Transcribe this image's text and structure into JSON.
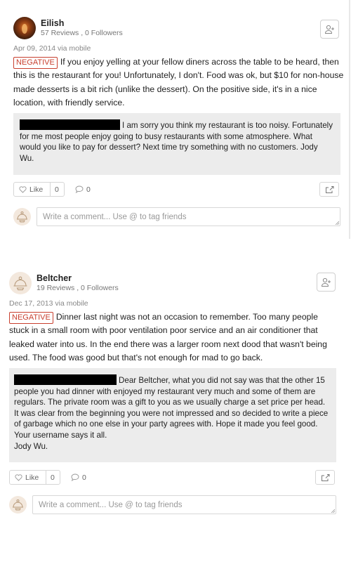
{
  "reviews": [
    {
      "user": "Eilish",
      "stats": "57 Reviews , 0 Followers",
      "date": "Apr 09, 2014 via mobile",
      "badge": "NEGATIVE",
      "text": "If you enjoy yelling at your fellow diners across the table to be heard, then this is the restaurant for you! Unfortunately, I don't. Food was ok, but $10 for non-house made desserts is a bit rich (unlike the dessert). On the positive side, it's in a nice location, with friendly service.",
      "reply": "I am sorry you think my restaurant is too noisy. Fortunately for me most people enjoy going to busy restaurants with some atmosphere. What would you like to pay for dessert? Next time try something with no customers. Jody Wu.",
      "like_label": "Like",
      "like_count": "0",
      "comment_count": "0",
      "comment_placeholder": "Write a comment... Use @ to tag friends"
    },
    {
      "user": "Beltcher",
      "stats": "19 Reviews , 0 Followers",
      "date": "Dec 17, 2013 via mobile",
      "badge": "NEGATIVE",
      "text": "Dinner last night was not an occasion to remember. Too many people stuck in a small room with poor ventilation poor service and an air conditioner that leaked water into us. In the end there was a larger room next dood that wasn't being used. The food was good but that's not enough for mad to go back.",
      "reply_lines": [
        "Dear Beltcher, what you did not say was that the other 15",
        "people you had dinner with enjoyed my restaurant very much and some of them are",
        "regulars. The private room was a gift to you as we usually charge a set price per head.",
        "It was clear from the beginning you were not impressed and so decided to write a piece",
        "of garbage which no one else in your party agrees with. Hope it made you feel good.",
        "Your username says it all.",
        "Jody Wu."
      ],
      "like_label": "Like",
      "like_count": "0",
      "comment_count": "0",
      "comment_placeholder": "Write a comment... Use @ to tag friends"
    }
  ],
  "icons": {
    "follow": "add-user-icon",
    "like": "heart-outline-icon",
    "comment": "speech-bubble-icon",
    "share": "share-icon",
    "commenter": "default-avatar-icon"
  },
  "colors": {
    "negative": "#c8402f",
    "reply_bg": "#ececec"
  }
}
